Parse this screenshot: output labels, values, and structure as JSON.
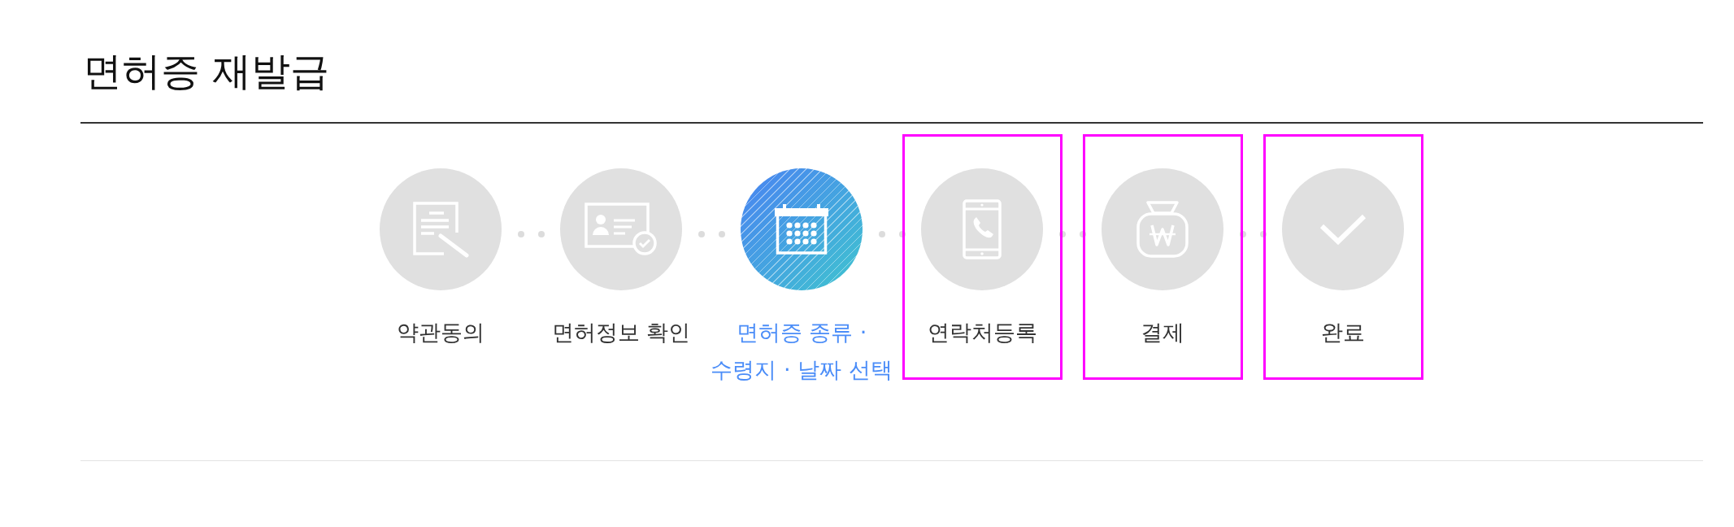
{
  "page": {
    "title": "면허증 재발급"
  },
  "steps": [
    {
      "label": "약관동의",
      "active": false,
      "highlighted": false
    },
    {
      "label": "면허정보 확인",
      "active": false,
      "highlighted": false
    },
    {
      "label": "면허증 종류 · 수령지 · 날짜 선택",
      "active": true,
      "highlighted": false
    },
    {
      "label": "연락처등록",
      "active": false,
      "highlighted": true
    },
    {
      "label": "결제",
      "active": false,
      "highlighted": true
    },
    {
      "label": "완료",
      "active": false,
      "highlighted": true
    }
  ]
}
